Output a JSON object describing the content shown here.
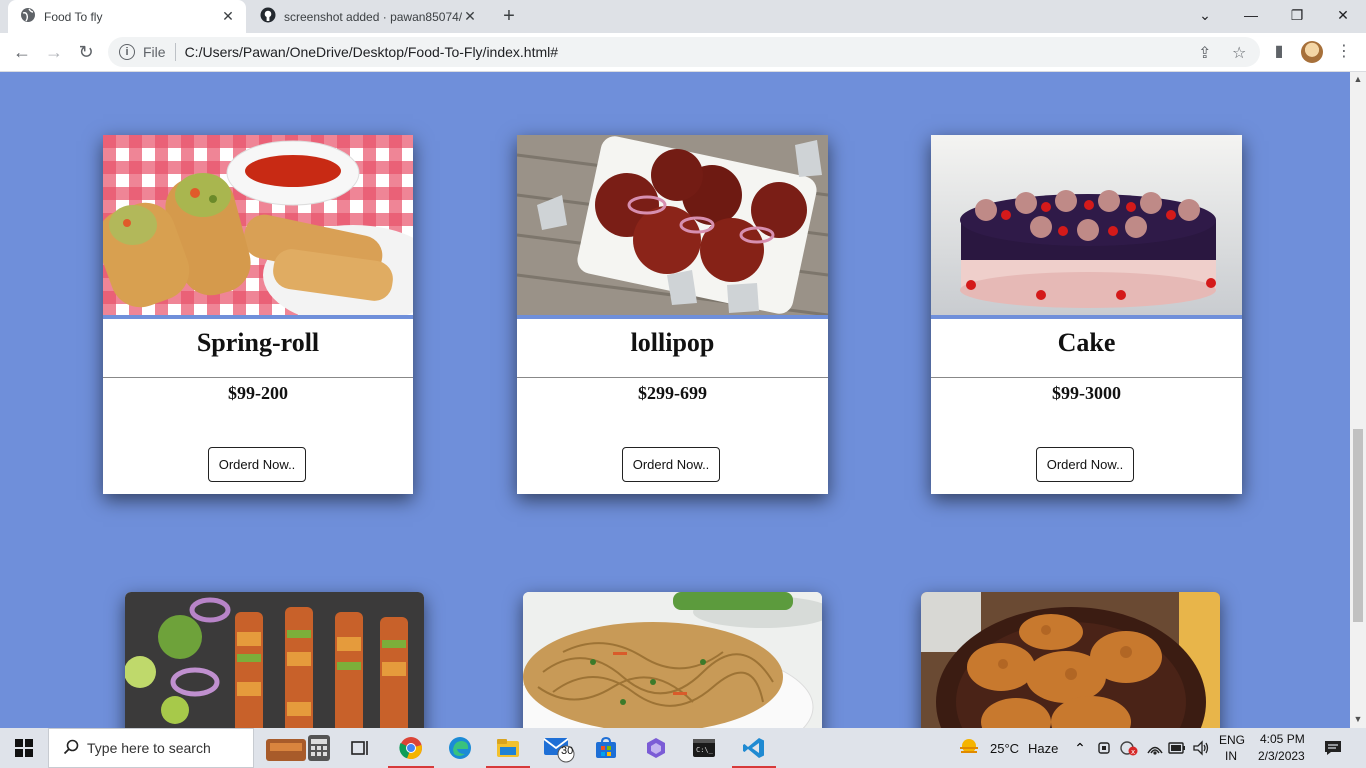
{
  "browser": {
    "tabs": [
      {
        "title": "Food To fly",
        "active": true
      },
      {
        "title": "screenshot added · pawan85074/",
        "active": false
      }
    ],
    "address": {
      "scheme_label": "File",
      "url": "C:/Users/Pawan/OneDrive/Desktop/Food-To-Fly/index.html#"
    }
  },
  "page": {
    "background": "#6f8fda",
    "cards": [
      {
        "name": "Spring-roll",
        "price": "$99-200",
        "button": "Orderd Now..",
        "image": "spring-roll-photo"
      },
      {
        "name": "lollipop",
        "price": "$299-699",
        "button": "Orderd Now..",
        "image": "chicken-lollipop-photo"
      },
      {
        "name": "Cake",
        "price": "$99-3000",
        "button": "Orderd Now..",
        "image": "chocolate-cake-photo"
      },
      {
        "image": "paneer-tikka-skewers-photo"
      },
      {
        "image": "hakka-noodles-photo"
      },
      {
        "image": "fried-patties-photo"
      }
    ]
  },
  "taskbar": {
    "search_placeholder": "Type here to search",
    "mail_badge": "30",
    "weather": {
      "temp": "25°C",
      "condition": "Haze"
    },
    "language": {
      "lang": "ENG",
      "region": "IN"
    },
    "clock": {
      "time": "4:05 PM",
      "date": "2/3/2023"
    }
  }
}
